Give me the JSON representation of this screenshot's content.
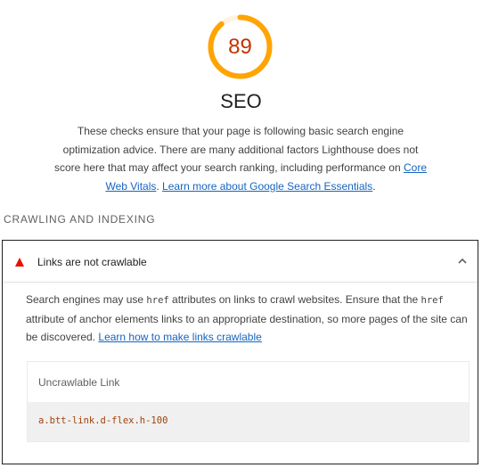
{
  "score": {
    "value": "89",
    "fraction": 0.89,
    "color": "#ffa400",
    "text_color": "#c33300",
    "track_color": "#fff3e0"
  },
  "category": {
    "title": "SEO",
    "description_part1": "These checks ensure that your page is following basic search engine optimization advice. There are many additional factors Lighthouse does not score here that may affect your search ranking, including performance on ",
    "link1": "Core Web Vitals",
    "description_part2": ". ",
    "link2": "Learn more about Google Search Essentials",
    "description_part3": "."
  },
  "group": {
    "title": "CRAWLING AND INDEXING"
  },
  "audit": {
    "status_icon": "fail-triangle-icon",
    "status_color": "#eb0f00",
    "title": "Links are not crawlable",
    "expand_icon": "chevron-up-icon",
    "desc_part1": "Search engines may use ",
    "code1": "href",
    "desc_part2": " attributes on links to crawl websites. Ensure that the ",
    "code2": "href",
    "desc_part3": " attribute of anchor elements links to an appropriate destination, so more pages of the site can be discovered. ",
    "learn_link": "Learn how to make links crawlable",
    "table": {
      "header": "Uncrawlable Link",
      "rows": [
        "a.btt-link.d-flex.h-100"
      ]
    }
  }
}
